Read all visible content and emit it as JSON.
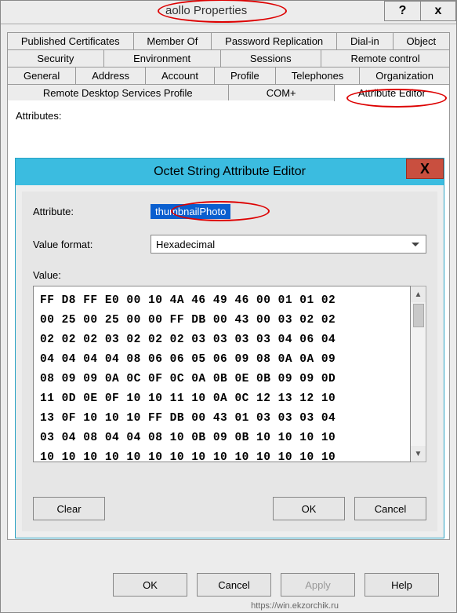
{
  "window": {
    "title": "aollo Properties",
    "help_btn": "?",
    "close_btn": "x"
  },
  "tabs": {
    "row1": [
      "Published Certificates",
      "Member Of",
      "Password Replication",
      "Dial-in",
      "Object"
    ],
    "row2": [
      "Security",
      "Environment",
      "Sessions",
      "Remote control"
    ],
    "row3": [
      "General",
      "Address",
      "Account",
      "Profile",
      "Telephones",
      "Organization"
    ],
    "row4": [
      "Remote Desktop Services Profile",
      "COM+",
      "Attribute Editor"
    ],
    "active": "Attribute Editor"
  },
  "panel": {
    "attributes_label": "Attributes:"
  },
  "editor": {
    "title": "Octet String Attribute Editor",
    "close": "X",
    "attribute_label": "Attribute:",
    "attribute_value": "thumbnailPhoto",
    "format_label": "Value format:",
    "format_value": "Hexadecimal",
    "value_label": "Value:",
    "hex_rows": [
      "FF D8 FF E0 00 10 4A 46 49 46 00 01 01 02",
      "00 25 00 25 00 00 FF DB 00 43 00 03 02 02",
      "02 02 02 03 02 02 02 03 03 03 03 04 06 04",
      "04 04 04 04 08 06 06 05 06 09 08 0A 0A 09",
      "08 09 09 0A 0C 0F 0C 0A 0B 0E 0B 09 09 0D",
      "11 0D 0E 0F 10 10 11 10 0A 0C 12 13 12 10",
      "13 0F 10 10 10 FF DB 00 43 01 03 03 03 04",
      "03 04 08 04 04 08 10 0B 09 0B 10 10 10 10",
      "10 10 10 10 10 10 10 10 10 10 10 10 10 10"
    ],
    "buttons": {
      "clear": "Clear",
      "ok": "OK",
      "cancel": "Cancel"
    }
  },
  "outer_buttons": {
    "ok": "OK",
    "cancel": "Cancel",
    "apply": "Apply",
    "help": "Help"
  },
  "watermark": "https://win.ekzorchik.ru"
}
